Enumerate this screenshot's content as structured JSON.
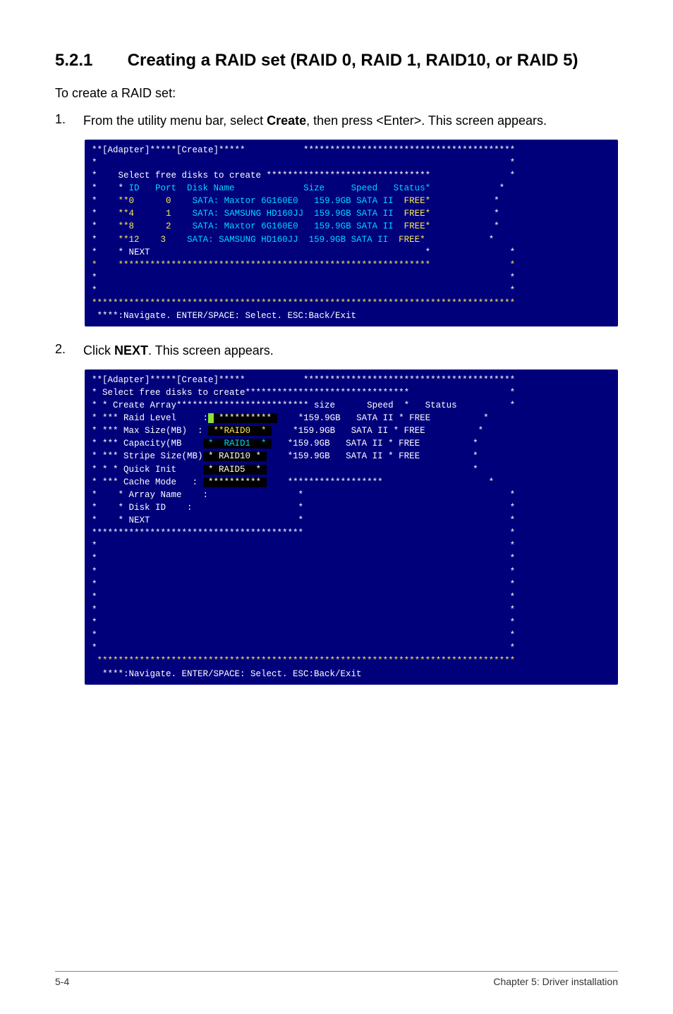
{
  "heading": {
    "number": "5.2.1",
    "title": "Creating a RAID set (RAID 0, RAID 1, RAID10, or RAID 5)"
  },
  "intro": "To create a RAID set:",
  "step1": {
    "num": "1.",
    "text_a": "From the utility menu bar, select ",
    "bold": "Create",
    "text_b": ", then press <Enter>. This screen appears."
  },
  "step2": {
    "num": "2.",
    "text_a": "Click ",
    "bold": "NEXT",
    "text_b": ". This screen appears."
  },
  "term1": {
    "top": "**[Adapter]*****[Create]*****           ****************************************",
    "box_top": "*                                                                              *",
    "select": "*    Select free disks to create *******************************               *",
    "hdr": {
      "pre": "*    * ",
      "id": "ID",
      "port": "   Port",
      "disk": "  Disk Name",
      "size": "             Size",
      "speed": "     Speed",
      "status": "   Status*",
      "suf": "             *"
    },
    "rows": [
      {
        "id": "**0",
        "port": " 0",
        "disk": "SATA: Maxtor 6G160E0",
        "size": "   159.9GB",
        "speed": " SATA II",
        "status": "  FREE*"
      },
      {
        "id": "**4",
        "port": " 1",
        "disk": "SATA: SAMSUNG HD160JJ",
        "size": "  159.9GB",
        "speed": " SATA II",
        "status": "  FREE*"
      },
      {
        "id": "**8",
        "port": " 2",
        "disk": "SATA: Maxtor 6G160E0",
        "size": "   159.9GB",
        "speed": " SATA II",
        "status": "  FREE*"
      },
      {
        "id": "**12",
        "port": "3",
        "disk": "SATA: SAMSUNG HD160JJ",
        "size": "  159.9GB",
        "speed": " SATA II",
        "status": "  FREE*"
      }
    ],
    "next": "*    * NEXT                                                    *               *",
    "box_mid": "*    ***********************************************************               *",
    "empty": "*                                                                              *",
    "stars": "********************************************************************************",
    "nav": " ****:Navigate. ENTER/SPACE: Select. ESC:Back/Exit"
  },
  "term2": {
    "top": "**[Adapter]*****[Create]*****           ****************************************",
    "sel": "* Select free disks to create*******************************                   *",
    "hdr": "* * Create Array************************* size      Speed  *   Status          *",
    "row0": {
      "a": "* *** Raid Level     :",
      "menu": " ********** ",
      "b": "*159.9GB",
      "c": "   SATA II",
      "d": " * FREE",
      "e": "          *"
    },
    "row1": {
      "a": "* *** Max Size(MB)  :",
      "menu": " **RAID0  * ",
      "b": "*159.9GB",
      "c": "   SATA II",
      "d": " * FREE",
      "e": "          *"
    },
    "row2": {
      "a": "* *** Capacity(MB",
      "menu": " *  RAID1  * ",
      "b": "*159.9GB",
      "c": "   SATA II",
      "d": " * FREE",
      "e": "          *"
    },
    "row3": {
      "a": "* *** Stripe Size(MB)",
      "menu": " * RAID10 * ",
      "b": "*159.9GB",
      "c": "   SATA II",
      "d": " * FREE",
      "e": "          *"
    },
    "row4": {
      "a": "* * * Quick Init",
      "menu": " * RAID5  * ",
      "b": "",
      "c": "",
      "d": "",
      "e": "                                       *"
    },
    "row5": {
      "a": "* *** Cache Mode   : ",
      "menu": " ********** ",
      "b": "",
      "c": "******************",
      "d": "",
      "e": "                    *"
    },
    "row6": "*    * Array Name    :                 *                                       *",
    "row7": "*    * Disk ID    :                    *                                       *",
    "row8": "*    * NEXT                            *                                       *",
    "mid": "****************************************                                       *",
    "empty": "*                                                                              *",
    "stars": " *******************************************************************************",
    "nav": "  ****:Navigate. ENTER/SPACE: Select. ESC:Back/Exit"
  },
  "footer": {
    "left": "5-4",
    "right": "Chapter 5: Driver installation"
  }
}
